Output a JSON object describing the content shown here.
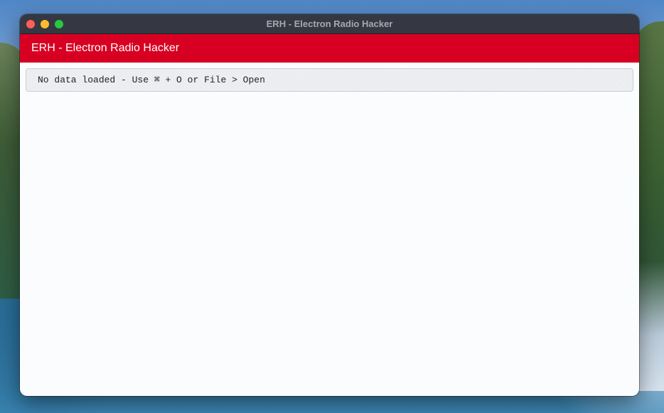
{
  "window": {
    "title": "ERH - Electron Radio Hacker"
  },
  "app": {
    "header_title": "ERH - Electron Radio Hacker"
  },
  "status": {
    "message": "No data loaded - Use ⌘ + O or File > Open"
  },
  "colors": {
    "header_bg": "#d70022",
    "titlebar_bg": "#353842"
  }
}
